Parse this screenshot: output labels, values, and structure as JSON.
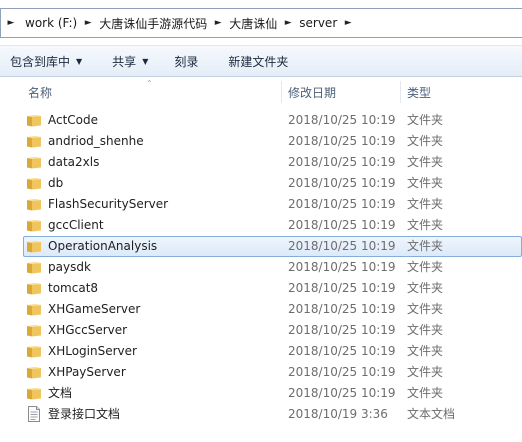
{
  "address_bar": {
    "crumbs": [
      {
        "label": "work (F:)"
      },
      {
        "label": "大唐诛仙手游源代码"
      },
      {
        "label": "大唐诛仙"
      },
      {
        "label": "server"
      }
    ]
  },
  "toolbar": {
    "include_library": "包含到库中",
    "share": "共享",
    "burn": "刻录",
    "new_folder": "新建文件夹"
  },
  "columns": {
    "name": "名称",
    "date": "修改日期",
    "type": "类型"
  },
  "files": [
    {
      "name": "ActCode",
      "date": "2018/10/25 10:19",
      "type": "文件夹",
      "kind": "folder",
      "selected": false
    },
    {
      "name": "andriod_shenhe",
      "date": "2018/10/25 10:19",
      "type": "文件夹",
      "kind": "folder",
      "selected": false
    },
    {
      "name": "data2xls",
      "date": "2018/10/25 10:19",
      "type": "文件夹",
      "kind": "folder",
      "selected": false
    },
    {
      "name": "db",
      "date": "2018/10/25 10:19",
      "type": "文件夹",
      "kind": "folder",
      "selected": false
    },
    {
      "name": "FlashSecurityServer",
      "date": "2018/10/25 10:19",
      "type": "文件夹",
      "kind": "folder",
      "selected": false
    },
    {
      "name": "gccClient",
      "date": "2018/10/25 10:19",
      "type": "文件夹",
      "kind": "folder",
      "selected": false
    },
    {
      "name": "OperationAnalysis",
      "date": "2018/10/25 10:19",
      "type": "文件夹",
      "kind": "folder",
      "selected": true
    },
    {
      "name": "paysdk",
      "date": "2018/10/25 10:19",
      "type": "文件夹",
      "kind": "folder",
      "selected": false
    },
    {
      "name": "tomcat8",
      "date": "2018/10/25 10:19",
      "type": "文件夹",
      "kind": "folder",
      "selected": false
    },
    {
      "name": "XHGameServer",
      "date": "2018/10/25 10:19",
      "type": "文件夹",
      "kind": "folder",
      "selected": false
    },
    {
      "name": "XHGccServer",
      "date": "2018/10/25 10:19",
      "type": "文件夹",
      "kind": "folder",
      "selected": false
    },
    {
      "name": "XHLoginServer",
      "date": "2018/10/25 10:19",
      "type": "文件夹",
      "kind": "folder",
      "selected": false
    },
    {
      "name": "XHPayServer",
      "date": "2018/10/25 10:19",
      "type": "文件夹",
      "kind": "folder",
      "selected": false
    },
    {
      "name": "文档",
      "date": "2018/10/25 10:19",
      "type": "文件夹",
      "kind": "folder",
      "selected": false
    },
    {
      "name": "登录接口文档",
      "date": "2018/10/19 3:36",
      "type": "文本文档",
      "kind": "text",
      "selected": false
    }
  ],
  "colors": {
    "folder": "#f1c55e",
    "selection_border": "#84acdd",
    "toolbar_top": "#f6f9fd",
    "toolbar_bottom": "#e4edf8"
  }
}
